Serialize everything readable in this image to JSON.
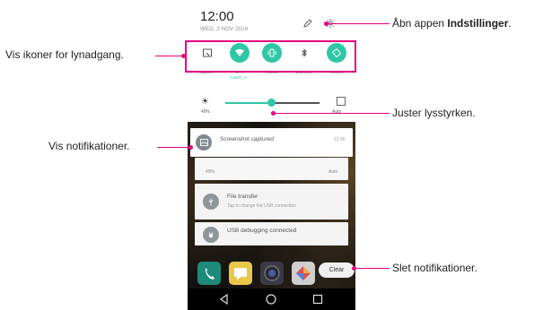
{
  "status": {
    "time": "12:00",
    "date": "WED, 2 NOV 2016"
  },
  "quick_settings": [
    {
      "label": "Capture+",
      "icon": "capture-plus-icon",
      "on": false
    },
    {
      "label": "Wi-Fi",
      "sub": "mowifi_m",
      "icon": "wifi-icon",
      "on": true
    },
    {
      "label": "Vibrate",
      "icon": "vibrate-icon",
      "on": true
    },
    {
      "label": "Bluetooth",
      "icon": "bluetooth-icon",
      "on": false
    },
    {
      "label": "Rotation",
      "icon": "rotation-icon",
      "on": true
    }
  ],
  "brightness": {
    "percent_label": "49%",
    "auto_label": "Auto",
    "level": 0.49
  },
  "notifications": [
    {
      "title": "Screenshot captured",
      "time": "12:00"
    },
    {
      "title": "49%",
      "time": "Auto"
    },
    {
      "title": "File transfer",
      "subtitle": "Tap to change the USB connection"
    },
    {
      "title": "USB debugging connected"
    }
  ],
  "clear_label": "Clear",
  "callouts": {
    "settings_pre": "Åbn appen ",
    "settings_bold": "Indstillinger",
    "settings_post": ".",
    "quick_access": "Vis ikoner for lynadgang.",
    "brightness": "Juster lysstyrken.",
    "notifications": "Vis notifikationer.",
    "clear": "Slet notifikationer."
  },
  "colors": {
    "accent": "#2fc7a7",
    "callout": "#e6007e"
  }
}
